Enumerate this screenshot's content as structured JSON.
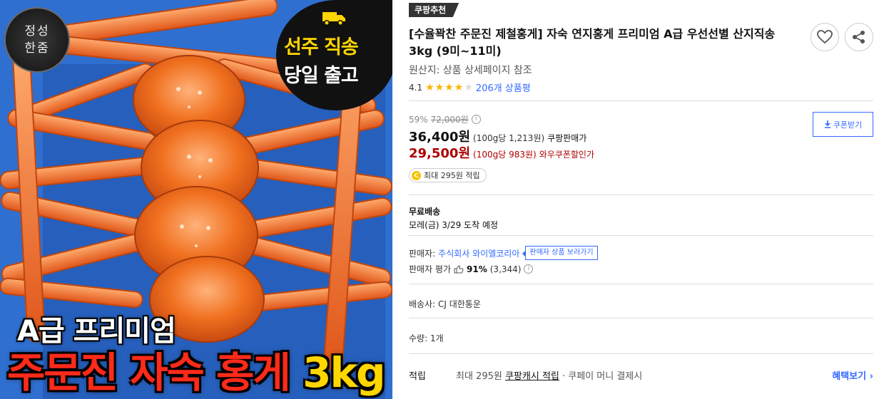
{
  "image": {
    "seal_line1": "정성",
    "seal_line2": "한줌",
    "badge_line1": "선주 직송",
    "badge_line2": "당일 출고",
    "caption_line1": "A급 프리미엄",
    "caption_red": "주문진 자숙 홍게",
    "caption_yellow": "3kg",
    "colors": {
      "crab": "#f06a1c",
      "box": "#2f6fd0",
      "badge_yellow": "#ffd600",
      "caption_red": "#ff2a1a"
    }
  },
  "product": {
    "recommend_tag": "쿠팡추천",
    "title": "[수율꽉찬 주문진 제철홍게] 자숙 연지홍게 프리미엄 A급 우선선별 산지직송 3kg (9미~11미)",
    "origin": "원산지: 상품 상세페이지 참조",
    "rating_value": "4.1",
    "rating_stars": 4.1,
    "review_count": "206개 상품평",
    "wish_icon": "heart-icon",
    "share_icon": "share-icon"
  },
  "price": {
    "discount_rate": "59%",
    "original_price": "72,000원",
    "sale_price": "36,400원",
    "sale_unit": "(100g당 1,213원)",
    "sale_label": "쿠팡판매가",
    "coupon_price": "29,500원",
    "coupon_unit": "(100g당 983원)",
    "coupon_label": "와우쿠폰할인가",
    "coupon_button": "쿠폰받기",
    "points": "최대 295원 적립",
    "coin_symbol": "C"
  },
  "shipping": {
    "title": "무료배송",
    "arrival": "모레(금) 3/29 도착 예정",
    "seller_label": "판매자:",
    "seller_name": "주식회사 와이엘코리아",
    "seller_button": "판매자 상품 보러가기",
    "seller_rating_label": "판매자 평가",
    "seller_rating_pct": "91%",
    "seller_rating_count": "(3,344)",
    "carrier": "배송사: CJ 대한통운",
    "quantity": "수량: 1개"
  },
  "reward": {
    "label": "적립",
    "text_prefix": "최대 295원 ",
    "text_link": "쿠팡캐시 적립",
    "text_suffix": " · 쿠페이 머니 결제시",
    "benefit_link": "혜택보기 ›"
  }
}
